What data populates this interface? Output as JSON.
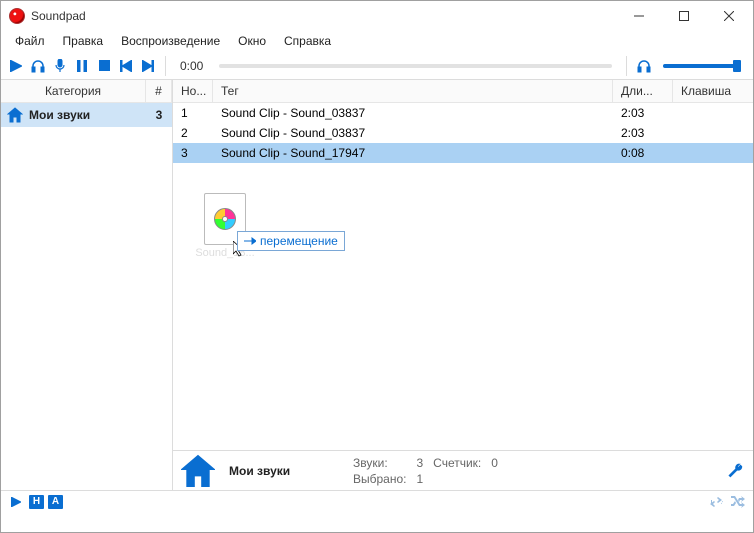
{
  "window": {
    "title": "Soundpad"
  },
  "menu": {
    "file": "Файл",
    "edit": "Правка",
    "playback": "Воспроизведение",
    "window": "Окно",
    "help": "Справка"
  },
  "toolbar": {
    "time": "0:00"
  },
  "sidebar": {
    "header_category": "Категория",
    "header_count": "#",
    "item": {
      "name": "Мои звуки",
      "count": "3"
    }
  },
  "table": {
    "headers": {
      "no": "Но...",
      "tag": "Тег",
      "duration": "Дли...",
      "key": "Клавиша"
    },
    "rows": [
      {
        "no": "1",
        "tag": "Sound Clip - Sound_03837",
        "dur": "2:03",
        "key": ""
      },
      {
        "no": "2",
        "tag": "Sound Clip - Sound_03837",
        "dur": "2:03",
        "key": ""
      },
      {
        "no": "3",
        "tag": "Sound Clip - Sound_17947",
        "dur": "0:08",
        "key": ""
      }
    ]
  },
  "drag": {
    "filename": "Sound_18...",
    "tooltip": "перемещение"
  },
  "infobar": {
    "title": "Мои звуки",
    "sounds_label": "Звуки:",
    "sounds_value": "3",
    "counter_label": "Счетчик:",
    "counter_value": "0",
    "selected_label": "Выбрано:",
    "selected_value": "1"
  },
  "bottom": {
    "h": "H",
    "a": "A"
  }
}
